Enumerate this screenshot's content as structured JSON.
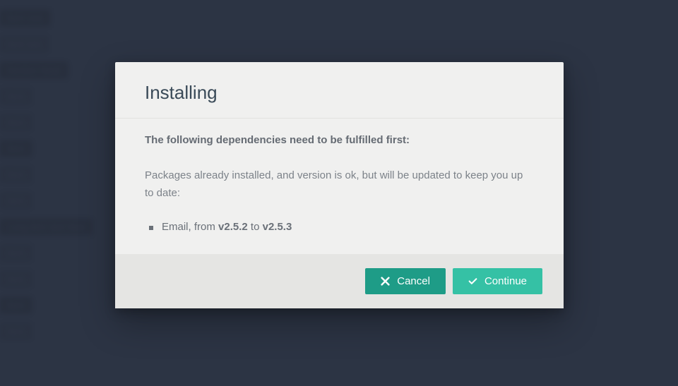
{
  "modal": {
    "title": "Installing",
    "dependencies_heading": "The following dependencies need to be fulfilled first:",
    "description": "Packages already installed, and version is ok, but will be updated to keep you up to date:",
    "packages": [
      {
        "name": "Email",
        "from_version": "v2.5.2",
        "to_version": "v2.5.3"
      }
    ],
    "buttons": {
      "cancel": "Cancel",
      "continue": "Continue"
    }
  }
}
